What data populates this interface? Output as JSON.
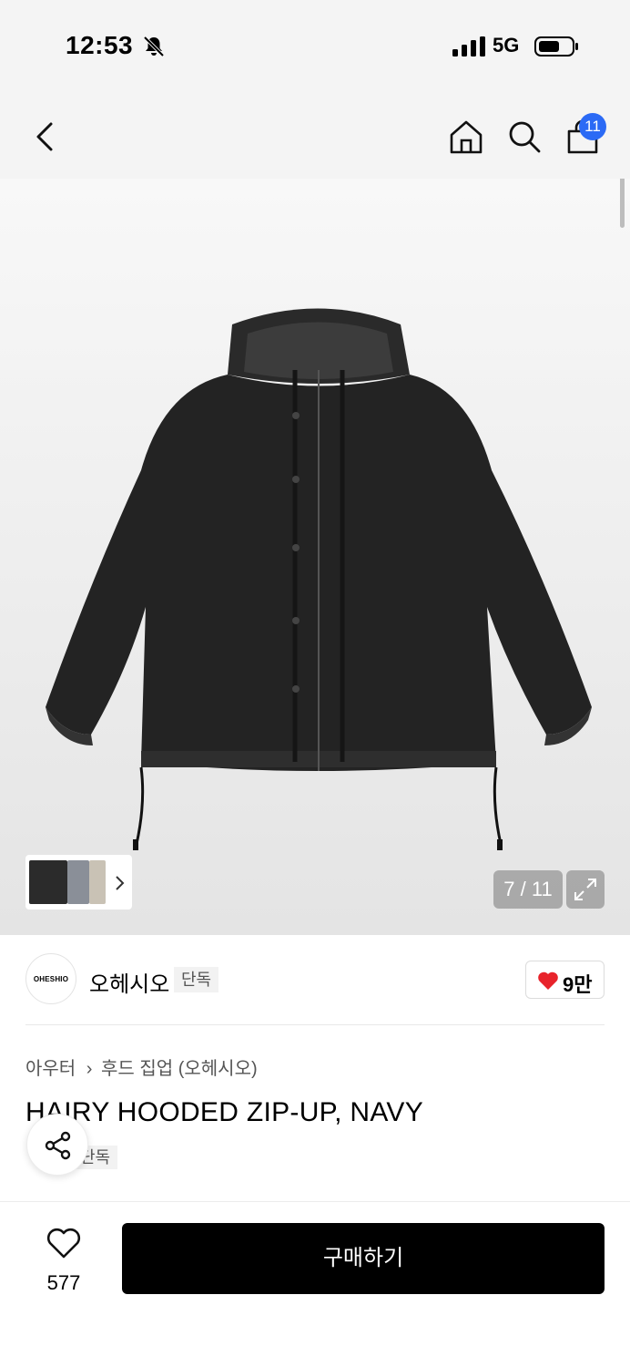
{
  "status": {
    "time": "12:53",
    "network": "5G"
  },
  "header": {
    "cart_count": "11"
  },
  "gallery": {
    "counter": "7 / 11"
  },
  "brand": {
    "logo_text": "OHESHIO",
    "name": "오헤시오",
    "tag": "단독",
    "like_count": "9만"
  },
  "breadcrumb": {
    "category": "아우터",
    "subcategory": "후드 집업 (오헤시오)"
  },
  "product": {
    "title": "HAIRY HOODED ZIP-UP, NAVY",
    "tag": "단독"
  },
  "bottom": {
    "wish_count": "577",
    "buy_label": "구매하기"
  },
  "colors": {
    "badge": "#2b6af5",
    "heart": "#e8232b",
    "buy_button": "#000000"
  }
}
